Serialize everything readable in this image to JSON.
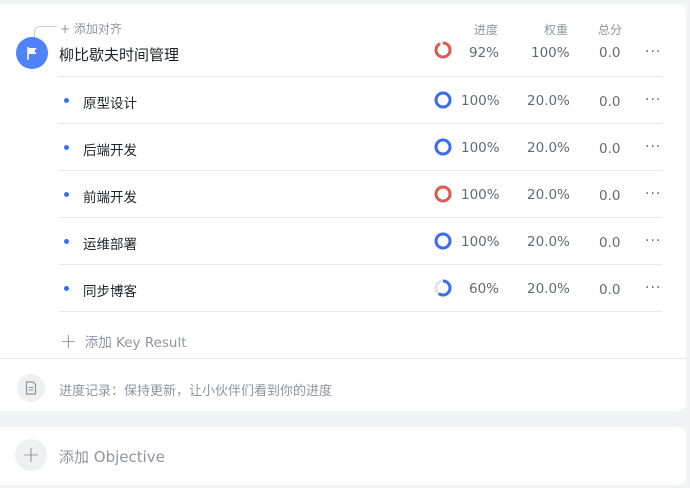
{
  "objective": {
    "align_label": "+ 添加对齐",
    "title": "柳比歇夫时间管理",
    "progress_text": "92%",
    "progress_value": 0.92,
    "weight": "100%",
    "score": "0.0",
    "status_color": "#e05a4f",
    "icon": "flag-icon"
  },
  "columns": {
    "progress": "进度",
    "weight": "权重",
    "score": "总分"
  },
  "key_results": [
    {
      "title": "原型设计",
      "progress_text": "100%",
      "progress_value": 1.0,
      "weight": "20.0%",
      "score": "0.0",
      "status_color": "#3c6cf0"
    },
    {
      "title": "后端开发",
      "progress_text": "100%",
      "progress_value": 1.0,
      "weight": "20.0%",
      "score": "0.0",
      "status_color": "#3c6cf0"
    },
    {
      "title": "前端开发",
      "progress_text": "100%",
      "progress_value": 1.0,
      "weight": "20.0%",
      "score": "0.0",
      "status_color": "#e05a4f"
    },
    {
      "title": "运维部署",
      "progress_text": "100%",
      "progress_value": 1.0,
      "weight": "20.0%",
      "score": "0.0",
      "status_color": "#3c6cf0"
    },
    {
      "title": "同步博客",
      "progress_text": "60%",
      "progress_value": 0.6,
      "weight": "20.0%",
      "score": "0.0",
      "status_color": "#3c6cf0"
    }
  ],
  "more_label": "···",
  "add_kr_label": "添加 Key Result",
  "progress_note": "进度记录：保持更新，让小伙伴们看到你的进度",
  "add_objective_label": "添加 Objective",
  "colors": {
    "accent": "#3c6cf0",
    "warning": "#e05a4f",
    "muted": "#8f959e",
    "track": "#dfe3eb"
  }
}
